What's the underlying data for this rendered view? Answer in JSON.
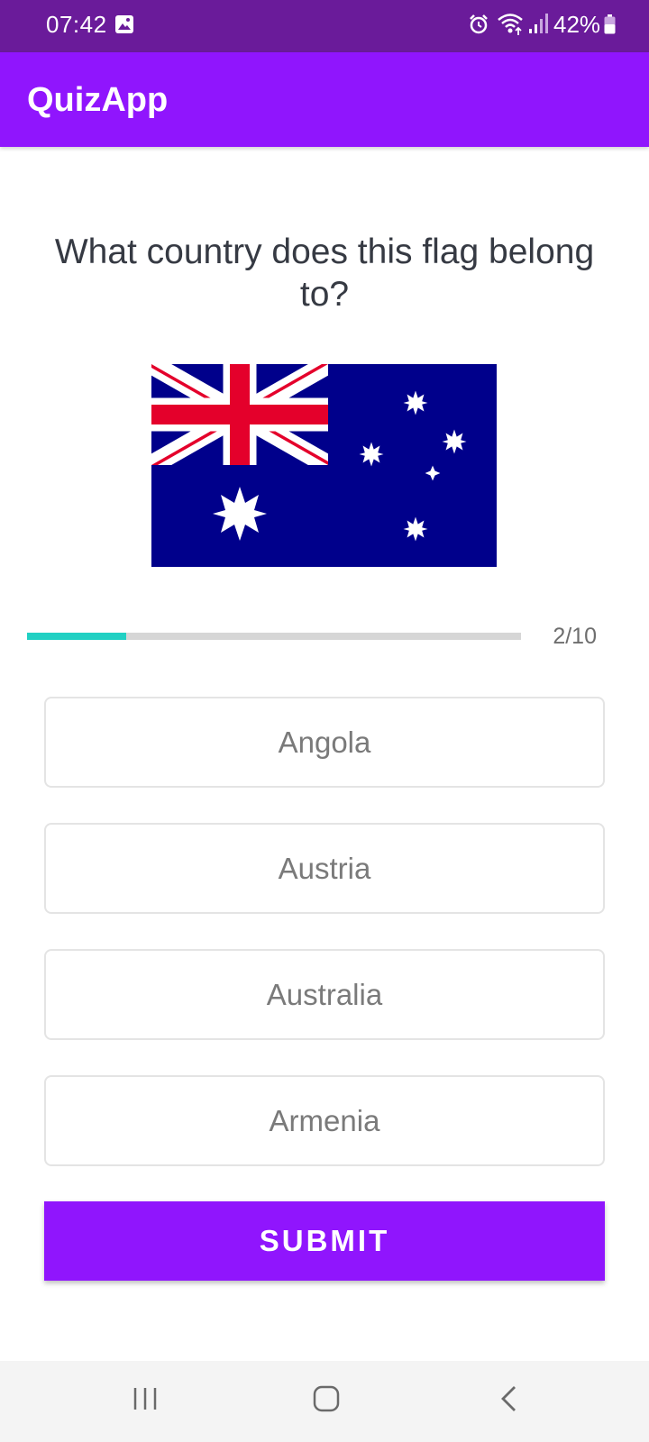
{
  "status_bar": {
    "time": "07:42",
    "battery": "42%",
    "icons": [
      "gallery-icon",
      "alarm-icon",
      "wifi-icon",
      "signal-icon",
      "battery-icon"
    ]
  },
  "app_bar": {
    "title": "QuizApp",
    "color": "#9015fd"
  },
  "question": {
    "text": "What country does this flag belong to?",
    "flag": "australia-flag"
  },
  "progress": {
    "current": 2,
    "max": 10,
    "label": "2/10",
    "fill_color": "#21d0c3"
  },
  "options": [
    {
      "label": "Angola"
    },
    {
      "label": "Austria"
    },
    {
      "label": "Australia"
    },
    {
      "label": "Armenia"
    }
  ],
  "submit": {
    "label": "SUBMIT"
  },
  "nav_bar": {
    "icons": [
      "recents-icon",
      "home-icon",
      "back-icon"
    ]
  }
}
